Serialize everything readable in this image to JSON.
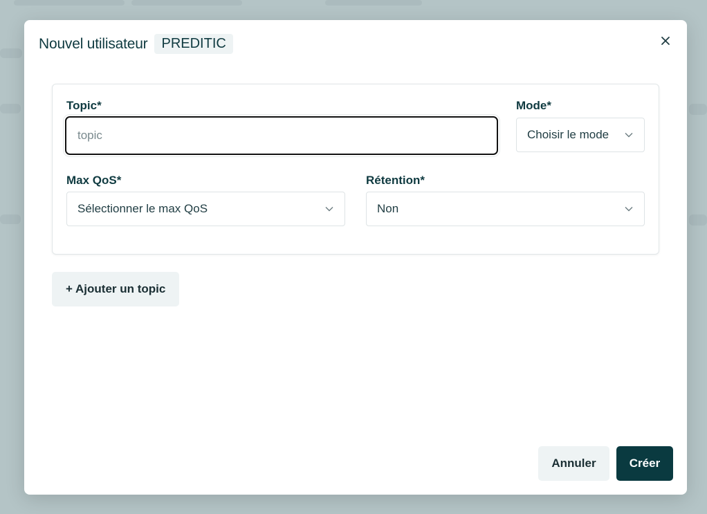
{
  "modal": {
    "title": "Nouvel utilisateur",
    "tenant_badge": "PREDITIC",
    "close_icon": "close-icon"
  },
  "topic_form": {
    "topic": {
      "label": "Topic*",
      "value": "",
      "placeholder": "topic"
    },
    "mode": {
      "label": "Mode*",
      "selected": "Choisir le mode"
    },
    "max_qos": {
      "label": "Max QoS*",
      "selected": "Sélectionner le max QoS"
    },
    "retention": {
      "label": "Rétention*",
      "selected": "Non"
    }
  },
  "actions": {
    "add_topic_label": "+ Ajouter un topic",
    "cancel_label": "Annuler",
    "create_label": "Créer"
  },
  "colors": {
    "primary": "#0a3a40",
    "secondary_button": "#eef3f4",
    "text_dark": "#0f3a40",
    "overlay": "#b4c4c6"
  }
}
